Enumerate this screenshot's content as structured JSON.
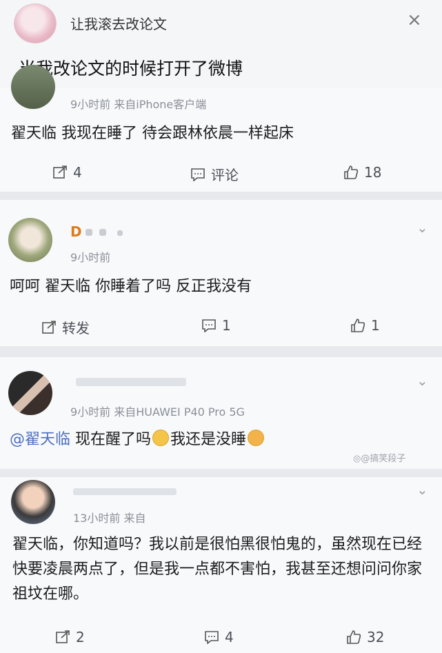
{
  "header": {
    "name": "让我滚去改论文",
    "close": "×",
    "title": "当我改论文的时候打开了微博"
  },
  "posts": [
    {
      "meta": "9小时前  来自iPhone客户端",
      "text": "翟天临 我现在睡了 待会跟林依晨一样起床",
      "repost": "4",
      "comment": "评论",
      "like": "18"
    },
    {
      "username": "D",
      "meta": "9小时前",
      "text": "呵呵 翟天临 你睡着了吗 反正我没有",
      "repost": "转发",
      "comment": "1",
      "like": "1"
    },
    {
      "meta": "9小时前  来自HUAWEI P40 Pro 5G",
      "mention": "@翟天临",
      "text_a": " 现在醒了吗",
      "text_b": "我还是没睡",
      "watermark": "◎@搞笑段子"
    },
    {
      "meta": "13小时前  来自",
      "text": "翟天临，你知道吗？我以前是很怕黑很怕鬼的，虽然现在已经快要凌晨两点了，但是我一点都不害怕，我甚至还想问问你家祖坟在哪。",
      "repost": "2",
      "comment": "4",
      "like": "32"
    }
  ],
  "icons": {
    "repost": "repost-icon",
    "comment": "comment-icon",
    "like": "like-icon",
    "chevron": "chevron-down-icon"
  }
}
